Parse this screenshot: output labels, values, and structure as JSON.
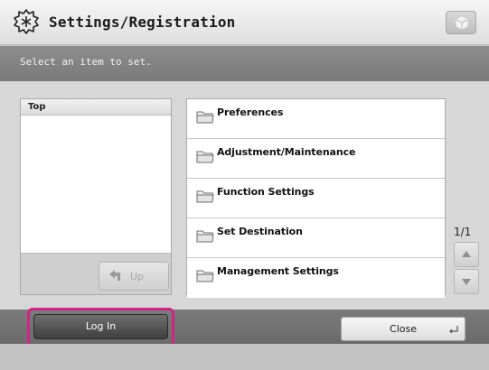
{
  "header": {
    "title": "Settings/Registration",
    "icon": "settings-gear-icon",
    "right_button_icon": "cube-icon"
  },
  "instruction": "Select an item to set.",
  "tree": {
    "header": "Top",
    "up_button": "Up"
  },
  "items": [
    {
      "label": "Preferences",
      "icon": "folder-icon"
    },
    {
      "label": "Adjustment/Maintenance",
      "icon": "folder-icon"
    },
    {
      "label": "Function Settings",
      "icon": "folder-icon"
    },
    {
      "label": "Set Destination",
      "icon": "folder-icon"
    },
    {
      "label": "Management Settings",
      "icon": "folder-icon"
    }
  ],
  "pager": {
    "page": "1/1"
  },
  "footer": {
    "login_label": "Log In",
    "close_label": "Close"
  },
  "colors": {
    "highlight": "#d0248b",
    "instruction_bar": "#858585"
  }
}
